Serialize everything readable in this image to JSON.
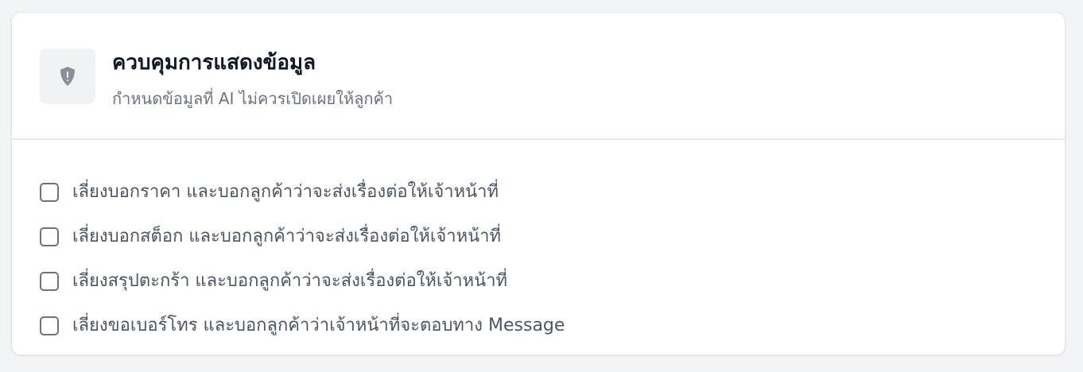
{
  "header": {
    "icon": "shield-alert-icon",
    "title": "ควบคุมการแสดงข้อมูล",
    "subtitle": "กำหนดข้อมูลที่ AI ไม่ควรเปิดเผยให้ลูกค้า"
  },
  "options": [
    {
      "label": "เลี่ยงบอกราคา และบอกลูกค้าว่าจะส่งเรื่องต่อให้เจ้าหน้าที่",
      "checked": false
    },
    {
      "label": "เลี่ยงบอกสต็อก และบอกลูกค้าว่าจะส่งเรื่องต่อให้เจ้าหน้าที่",
      "checked": false
    },
    {
      "label": "เลี่ยงสรุปตะกร้า และบอกลูกค้าว่าจะส่งเรื่องต่อให้เจ้าหน้าที่",
      "checked": false
    },
    {
      "label": "เลี่ยงขอเบอร์โทร และบอกลูกค้าว่าเจ้าหน้าที่จะตอบทาง Message",
      "checked": false
    }
  ],
  "colors": {
    "card_background": "#ffffff",
    "icon_color": "#8a9099",
    "checkbox_border": "#6b7280"
  }
}
